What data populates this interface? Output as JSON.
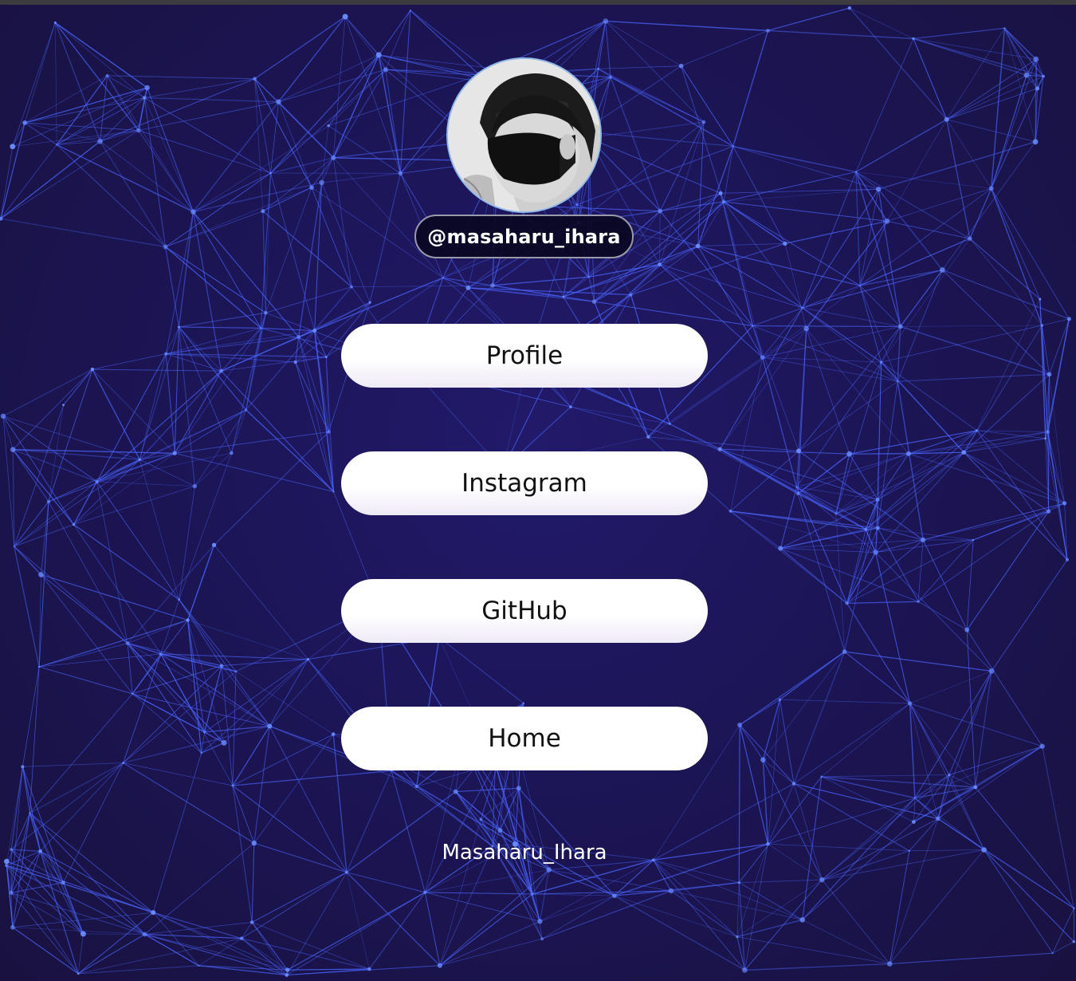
{
  "profile": {
    "handle": "@masaharu_ihara",
    "avatar_icon": "profile-photo"
  },
  "links": [
    {
      "label": "Profile"
    },
    {
      "label": "Instagram"
    },
    {
      "label": "GitHub"
    },
    {
      "label": "Home"
    }
  ],
  "footer": {
    "name": "Masaharu_Ihara"
  },
  "colors": {
    "background": "#1c1556",
    "network_line": "#4a66ff",
    "network_node": "#6a8cff",
    "button_bg": "#ffffff",
    "button_text": "#111111",
    "pill_border": "#9a9aa8"
  }
}
